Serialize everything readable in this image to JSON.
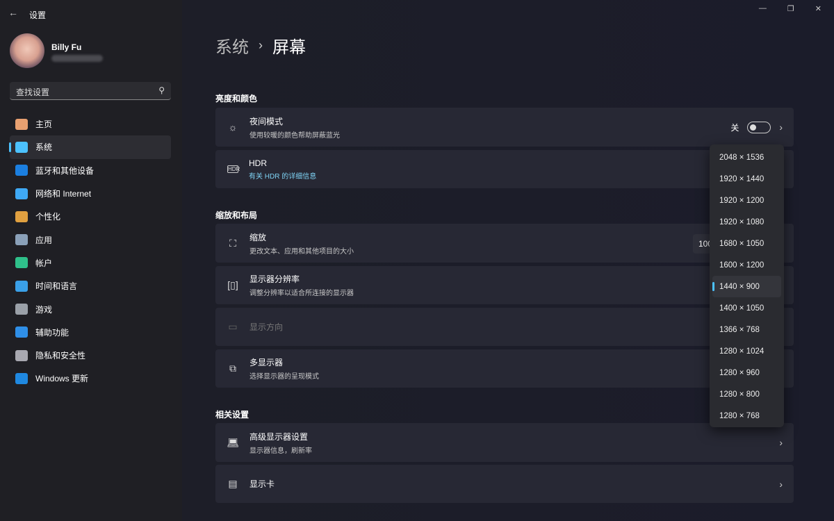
{
  "app": {
    "title": "设置",
    "back_icon": "arrow-left-icon"
  },
  "user": {
    "name": "Billy Fu"
  },
  "search": {
    "placeholder": "查找设置",
    "icon": "search-icon"
  },
  "window": {
    "minimize": "—",
    "maximize": "❐",
    "close": "✕"
  },
  "nav": [
    {
      "label": "主页",
      "icon": "home-icon",
      "color": "#e8a070"
    },
    {
      "label": "系统",
      "icon": "system-icon",
      "color": "#4cc2ff",
      "active": true
    },
    {
      "label": "蓝牙和其他设备",
      "icon": "bluetooth-icon",
      "color": "#1b7fe0"
    },
    {
      "label": "网络和 Internet",
      "icon": "wifi-icon",
      "color": "#3fa9f5"
    },
    {
      "label": "个性化",
      "icon": "brush-icon",
      "color": "#e0a040"
    },
    {
      "label": "应用",
      "icon": "apps-icon",
      "color": "#8aa0b8"
    },
    {
      "label": "帐户",
      "icon": "account-icon",
      "color": "#2fc08a"
    },
    {
      "label": "时间和语言",
      "icon": "globe-clock-icon",
      "color": "#3aa0e8"
    },
    {
      "label": "游戏",
      "icon": "gamepad-icon",
      "color": "#9aa0a8"
    },
    {
      "label": "辅助功能",
      "icon": "accessibility-icon",
      "color": "#2f8fe8"
    },
    {
      "label": "隐私和安全性",
      "icon": "shield-icon",
      "color": "#a8a8b0"
    },
    {
      "label": "Windows 更新",
      "icon": "update-icon",
      "color": "#1f88e0"
    }
  ],
  "breadcrumb": {
    "parent": "系统",
    "current": "屏幕"
  },
  "sections": {
    "brightness": "亮度和颜色",
    "scale_layout": "缩放和布局",
    "related": "相关设置"
  },
  "cards": {
    "night": {
      "title": "夜间模式",
      "sub": "使用较暖的颜色帮助屏蔽蓝光",
      "state": "关",
      "icon": "sun-icon"
    },
    "hdr": {
      "title": "HDR",
      "sub": "有关 HDR 的详细信息",
      "icon": "hdr-icon"
    },
    "scale": {
      "title": "缩放",
      "sub": "更改文本、应用和其他项目的大小",
      "value": "100%",
      "icon": "scale-icon"
    },
    "resolution": {
      "title": "显示器分辨率",
      "sub": "调整分辨率以适合所连接的显示器",
      "icon": "resolution-icon"
    },
    "orientation": {
      "title": "显示方向",
      "icon": "orientation-icon",
      "disabled": true
    },
    "multi": {
      "title": "多显示器",
      "sub": "选择显示器的呈现模式",
      "icon": "multi-monitor-icon"
    },
    "advanced": {
      "title": "高级显示器设置",
      "sub": "显示器信息，刷新率",
      "icon": "laptop-icon"
    },
    "gpu": {
      "title": "显示卡",
      "icon": "gpu-icon"
    }
  },
  "resolution_options": [
    "2048 × 1536",
    "1920 × 1440",
    "1920 × 1200",
    "1920 × 1080",
    "1680 × 1050",
    "1600 × 1200",
    "1440 × 900",
    "1400 × 1050",
    "1366 × 768",
    "1280 × 1024",
    "1280 × 960",
    "1280 × 800",
    "1280 × 768"
  ],
  "resolution_selected": "1440 × 900",
  "accent": "#4cc2ff"
}
